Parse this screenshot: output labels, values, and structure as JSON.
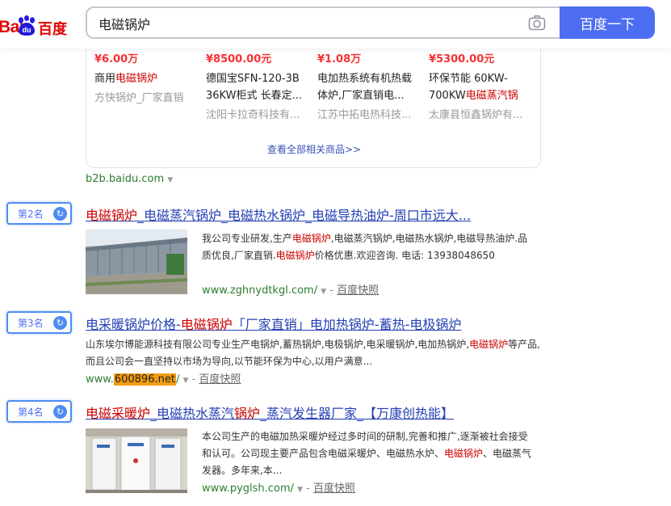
{
  "header": {
    "logo_bai": "Bai",
    "logo_du": "du",
    "logo_cn": "百度",
    "search_value": "电磁锅炉",
    "search_button": "百度一下",
    "camera_icon": "camera-icon"
  },
  "products": [
    {
      "price": "¥6.00万",
      "title_a": "商用",
      "title_hl": "电磁锅炉",
      "title_b": "",
      "shop": "方快锅炉_厂家直销"
    },
    {
      "price": "¥8500.00元",
      "title_a": "德国宝SFN-120-3B 36KW柜式 长春定...",
      "title_hl": "",
      "title_b": "",
      "shop": "沈阳卡拉奇科技有..."
    },
    {
      "price": "¥1.08万",
      "title_a": "电加热系统有机热载体炉,厂家直销电...",
      "title_hl": "",
      "title_b": "",
      "shop": "江苏中拓电热科技..."
    },
    {
      "price": "¥5300.00元",
      "title_a": "环保节能 60KW-700KW",
      "title_hl": "电磁蒸汽锅",
      "title_b": "",
      "shop": "太康县恒鑫锅炉有..."
    }
  ],
  "view_all": "查看全部相关商品>>",
  "source": "b2b.baidu.com",
  "results": [
    {
      "rank": "第2名",
      "title_hl": "电磁锅炉",
      "title_rest": "_电磁蒸汽锅炉_电磁热水锅炉_电磁导热油炉-周口市远大...",
      "snippet_a": "我公司专业研发,生产",
      "snippet_hl1": "电磁锅炉",
      "snippet_b": ",电磁蒸汽锅炉,电磁热水锅炉,电磁导热油炉.品质优良,厂家直销.",
      "snippet_hl2": "电磁锅炉",
      "snippet_c": "价格优惠.欢迎咨询. 电话: 13938048650",
      "url": "www.zghnydtkgl.com/",
      "snapshot": "百度快照"
    },
    {
      "rank": "第3名",
      "title_a": "电采暖锅炉价格-",
      "title_hl": "电磁锅炉",
      "title_rest": "「厂家直销」电加热锅炉-蓄热-电极锅炉",
      "snippet_a": "山东埃尔博能源科技有限公司专业生产电锅炉,蓄热锅炉,电极锅炉,电采暖锅炉,电加热锅炉,",
      "snippet_hl1": "电磁锅炉",
      "snippet_b": "等产品,而且公司会一直坚持以市场为导向,以节能环保为中心,以用户满意...",
      "url_a": "www.",
      "url_mark": "600896.net",
      "url_b": "/",
      "snapshot": "百度快照"
    },
    {
      "rank": "第4名",
      "title_hl": "电磁采暖炉",
      "title_rest_a": "_电磁热水蒸汽",
      "title_hl2": "锅炉",
      "title_rest_b": "_蒸汽发生器厂家_【万康创热能】",
      "snippet_a": "本公司生产的电磁加热采暖炉经过多时间的研制,完善和推广,逐渐被社会接受和认可。公司现主要产品包含电磁采暖炉、电磁热水炉、",
      "snippet_hl1": "电磁锅炉",
      "snippet_b": "、电磁蒸气发器。多年来,本...",
      "url": "www.pyglsh.com/",
      "snapshot": "百度快照"
    }
  ]
}
